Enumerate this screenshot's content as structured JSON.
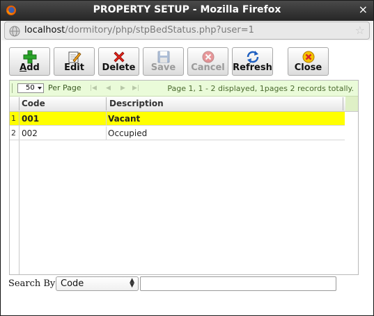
{
  "window": {
    "title": "PROPERTY SETUP - Mozilla Firefox",
    "close_glyph": "×"
  },
  "urlbar": {
    "host": "localhost",
    "path": "/dormitory/php/stpBedStatus.php?user=1"
  },
  "toolbar": {
    "add_first": "A",
    "add_rest": "dd",
    "edit_label": "Edit",
    "delete_label": "Delete",
    "save_label": "Save",
    "cancel_label": "Cancel",
    "refresh_label": "Refresh",
    "close_label": "Close"
  },
  "pager": {
    "page_size": "50",
    "per_page_label": "Per Page",
    "info": "Page 1, 1 - 2 displayed, 1pages 2 records totally."
  },
  "table": {
    "columns": [
      "Code",
      "Description"
    ],
    "rows": [
      {
        "num": "1",
        "code": "001",
        "description": "Vacant"
      },
      {
        "num": "2",
        "code": "002",
        "description": "Occupied"
      }
    ]
  },
  "search": {
    "label": "Search By:",
    "field_value": "Code",
    "input_value": ""
  },
  "colors": {
    "selected_row": "#ffff00",
    "pager_bg": "#eafbd9"
  }
}
